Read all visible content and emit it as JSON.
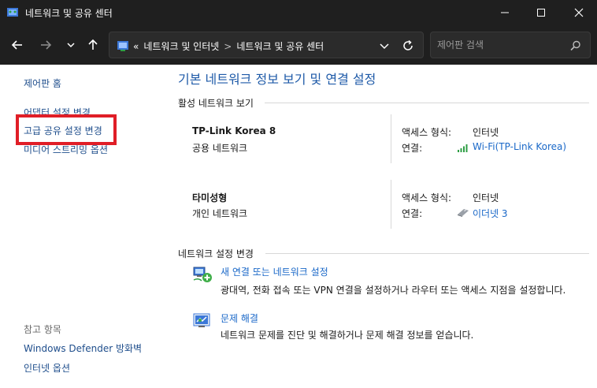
{
  "window": {
    "title": "네트워크 및 공유 센터"
  },
  "address": {
    "prefix": "«",
    "crumbs": [
      "네트워크 및 인터넷",
      "네트워크 및 공유 센터"
    ],
    "separator": ">"
  },
  "search": {
    "placeholder": "제어판 검색"
  },
  "sidebar": {
    "links": [
      "제어판 홈",
      "어댑터 설정 변경",
      "고급 공유 설정 변경",
      "미디어 스트리밍 옵션"
    ],
    "see_also_title": "참고 항목",
    "see_also": [
      "Windows Defender 방화벽",
      "인터넷 옵션"
    ]
  },
  "main": {
    "title": "기본 네트워크 정보 보기 및 연결 설정",
    "active_section": "활성 네트워크 보기",
    "networks": [
      {
        "name": "TP-Link Korea 8",
        "type": "공용 네트워크",
        "access_label": "액세스 형식:",
        "access_value": "인터넷",
        "conn_label": "연결:",
        "conn_value": "Wi-Fi(TP-Link Korea)",
        "conn_icon": "wifi-signal-icon"
      },
      {
        "name": "타미성형",
        "type": "개인 네트워크",
        "access_label": "액세스 형식:",
        "access_value": "인터넷",
        "conn_label": "연결:",
        "conn_value": "이더넷 3",
        "conn_icon": "ethernet-icon"
      }
    ],
    "change_section": "네트워크 설정 변경",
    "tasks": [
      {
        "link": "새 연결 또는 네트워크 설정",
        "desc": "광대역, 전화 접속 또는 VPN 연결을 설정하거나 라우터 또는 액세스 지점을 설정합니다.",
        "icon": "new-connection-icon"
      },
      {
        "link": "문제 해결",
        "desc": "네트워크 문제를 진단 및 해결하거나 문제 해결 정보를 얻습니다.",
        "icon": "troubleshoot-icon"
      }
    ]
  },
  "colors": {
    "titlebar": "#1f1f1f",
    "link": "#1a68c8",
    "title_blue": "#1e5aa8",
    "highlight": "#e01e27"
  }
}
